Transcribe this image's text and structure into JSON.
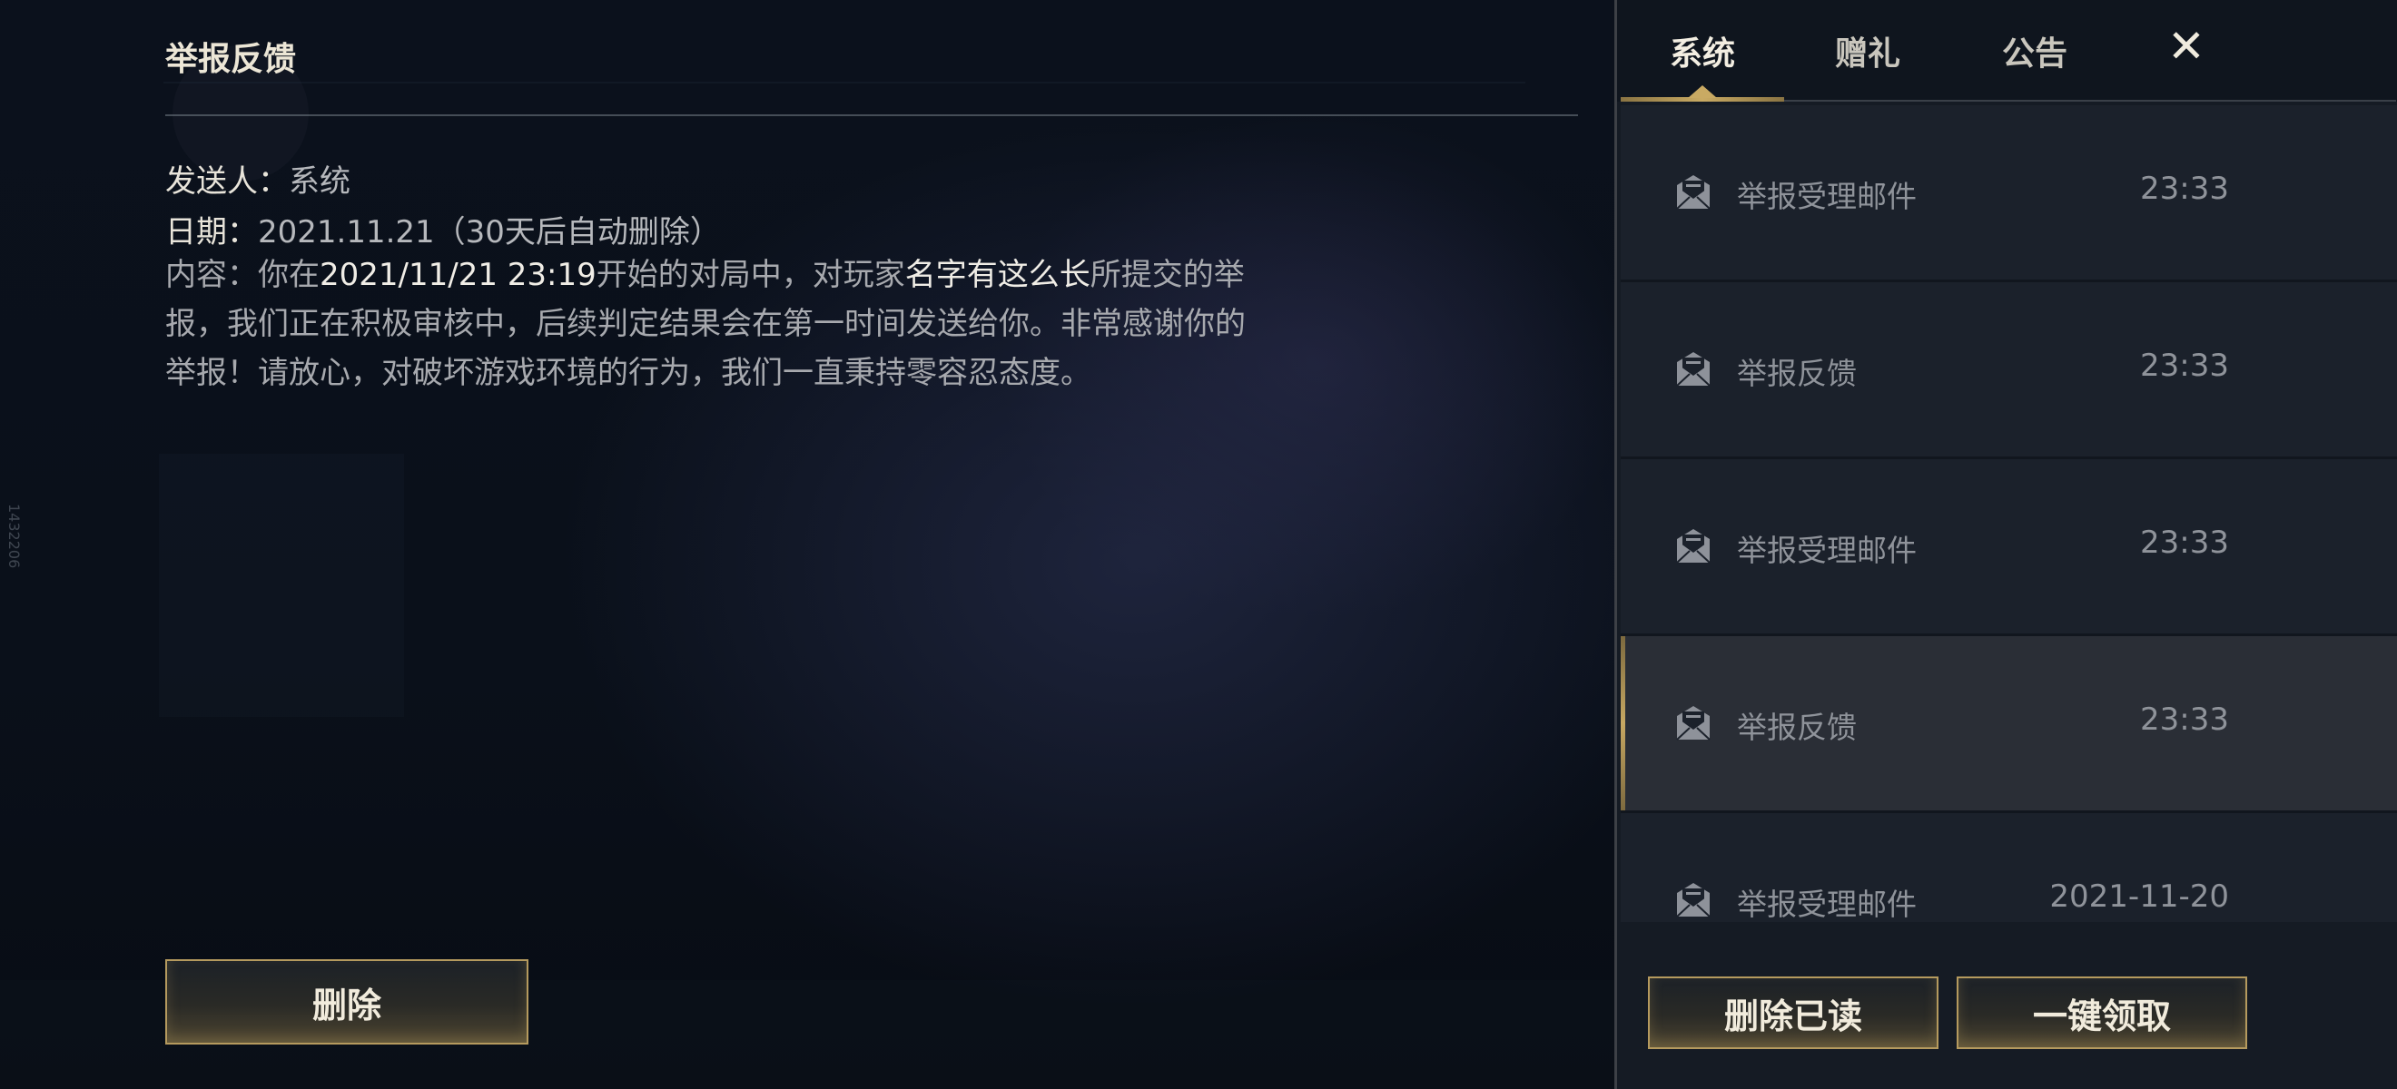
{
  "detail": {
    "title": "举报反馈",
    "sender_label": "发送人：",
    "sender_value": "系统",
    "date_label": "日期：",
    "date_value": "2021.11.21（30天后自动删除）",
    "content_label": "内容：",
    "content_part1": "你在",
    "content_time": "2021/11/21 23:19",
    "content_part2": "开始的对局中，对玩家",
    "content_player": "名字有这么长",
    "content_part3": "所提交的举报，我们正在积极审核中，后续判定结果会在第一时间发送给你。非常感谢你的举报！请放心，对破坏游戏环境的行为，我们一直秉持零容忍态度。",
    "delete_button": "删除"
  },
  "watermark": "1432206",
  "tabs": {
    "system": "系统",
    "gift": "赠礼",
    "notice": "公告",
    "close": "✕"
  },
  "mail_items": [
    {
      "name": "举报受理邮件",
      "time": "23:33",
      "selected": false
    },
    {
      "name": "举报反馈",
      "time": "23:33",
      "selected": false
    },
    {
      "name": "举报受理邮件",
      "time": "23:33",
      "selected": false
    },
    {
      "name": "举报反馈",
      "time": "23:33",
      "selected": true
    },
    {
      "name": "举报受理邮件",
      "time": "2021-11-20",
      "selected": false
    }
  ],
  "footer": {
    "delete_read": "删除已读",
    "claim_all": "一键领取"
  },
  "colors": {
    "gold_accent": "#c9aa63",
    "panel_bg": "#151b24",
    "selected_bg": "#2a2e36"
  }
}
